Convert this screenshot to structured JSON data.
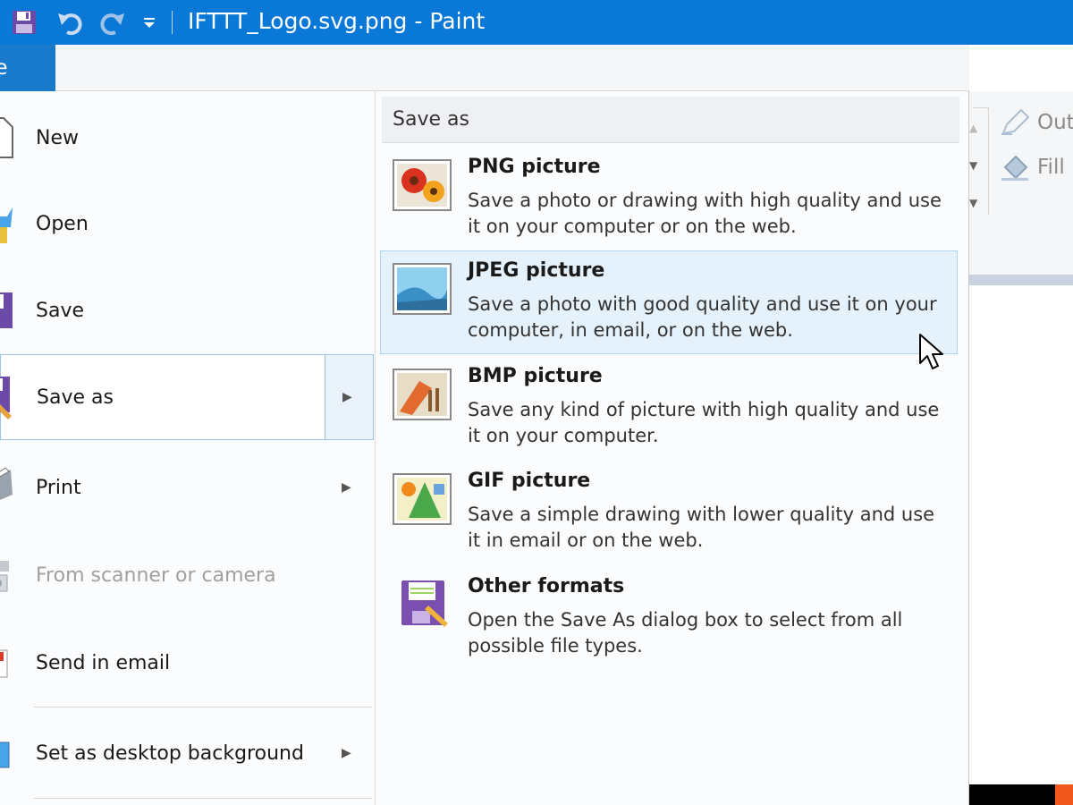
{
  "window": {
    "title": "IFTTT_Logo.svg.png - Paint"
  },
  "quick_access": {
    "save_icon": "floppy-disk-icon",
    "undo_icon": "undo-icon",
    "redo_icon": "redo-icon",
    "customize_icon": "dropdown-arrow-icon"
  },
  "ribbon": {
    "file_tab_label": "le",
    "outline_label": "Out",
    "fill_label": "Fill"
  },
  "file_menu": {
    "items": [
      {
        "label": "New",
        "icon": "new-file-icon"
      },
      {
        "label": "Open",
        "icon": "open-folder-icon"
      },
      {
        "label": "Save",
        "icon": "floppy-disk-icon"
      },
      {
        "label": "Save as",
        "icon": "save-as-icon",
        "has_submenu": true
      },
      {
        "label": "Print",
        "icon": "printer-icon",
        "has_submenu": true
      },
      {
        "label": "From scanner or camera",
        "icon": "scanner-icon",
        "disabled": true
      },
      {
        "label": "Send in email",
        "icon": "email-icon"
      },
      {
        "label": "Set as desktop background",
        "icon": "desktop-icon",
        "has_submenu": true
      }
    ]
  },
  "save_as_panel": {
    "header": "Save as",
    "formats": [
      {
        "title": "PNG picture",
        "description": "Save a photo or drawing with high quality and use it on your computer or on the web.",
        "icon": "png-flower-icon"
      },
      {
        "title": "JPEG picture",
        "description": "Save a photo with good quality and use it on your computer, in email, or on the web.",
        "icon": "jpeg-landscape-icon"
      },
      {
        "title": "BMP picture",
        "description": "Save any kind of picture with high quality and use it on your computer.",
        "icon": "bmp-brush-icon"
      },
      {
        "title": "GIF picture",
        "description": "Save a simple drawing with lower quality and use it in email or on the web.",
        "icon": "gif-shapes-icon"
      },
      {
        "title": "Other formats",
        "description": "Open the Save As dialog box to select from all possible file types.",
        "icon": "save-as-floppy-icon"
      }
    ]
  },
  "colors": {
    "titlebar": "#0a78d7",
    "file_tab": "#1979ca",
    "hover_bg": "#e5f1fb",
    "hover_border": "#b0d4f3"
  }
}
